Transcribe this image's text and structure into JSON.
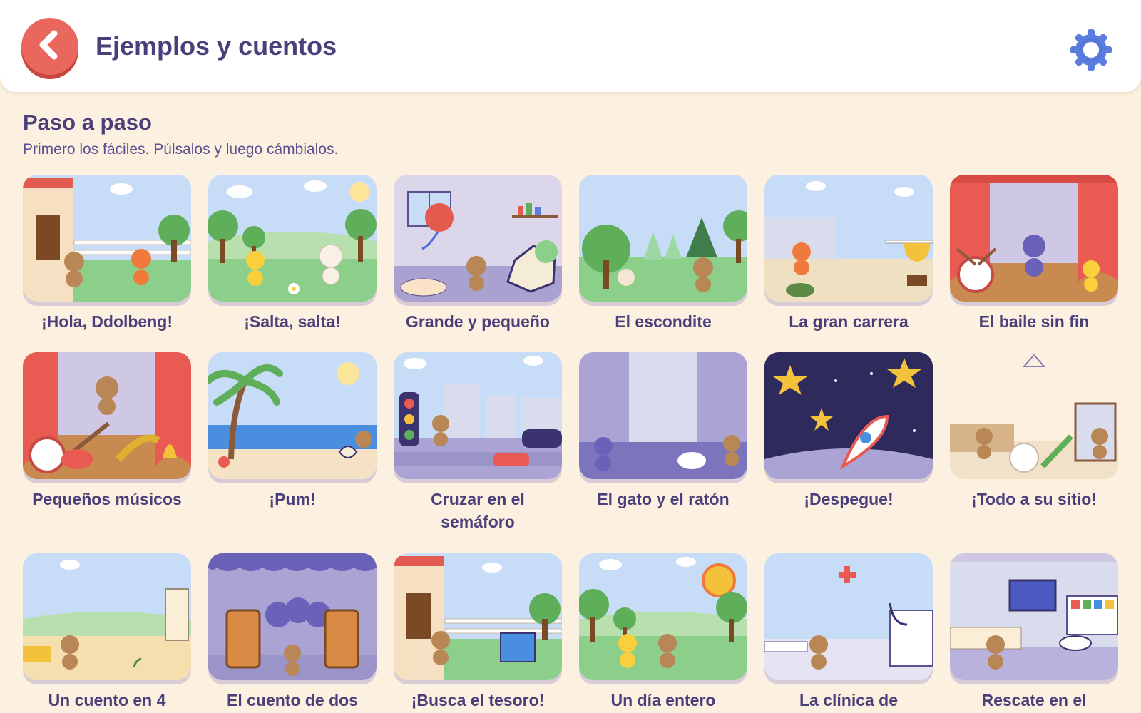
{
  "header": {
    "title": "Ejemplos y cuentos",
    "back_icon": "chevron-left-icon",
    "settings_icon": "gear-icon",
    "accent": "#ea675d",
    "settings_color": "#5b7de0"
  },
  "section": {
    "title": "Paso a paso",
    "subtitle": "Primero los fáciles. Púlsalos y luego cámbialos."
  },
  "cards": [
    {
      "label": "¡Hola, Ddolbeng!"
    },
    {
      "label": "¡Salta, salta!"
    },
    {
      "label": "Grande y pequeño"
    },
    {
      "label": "El escondite"
    },
    {
      "label": "La gran carrera"
    },
    {
      "label": "El baile sin fin"
    },
    {
      "label": "Pequeños músicos"
    },
    {
      "label": "¡Pum!"
    },
    {
      "label": "Cruzar en el semáforo"
    },
    {
      "label": "El gato y el ratón"
    },
    {
      "label": "¡Despegue!"
    },
    {
      "label": "¡Todo a su sitio!"
    },
    {
      "label": "Un cuento en 4"
    },
    {
      "label": "El cuento de dos"
    },
    {
      "label": "¡Busca el tesoro!"
    },
    {
      "label": "Un día entero"
    },
    {
      "label": "La clínica de"
    },
    {
      "label": "Rescate en el"
    }
  ]
}
